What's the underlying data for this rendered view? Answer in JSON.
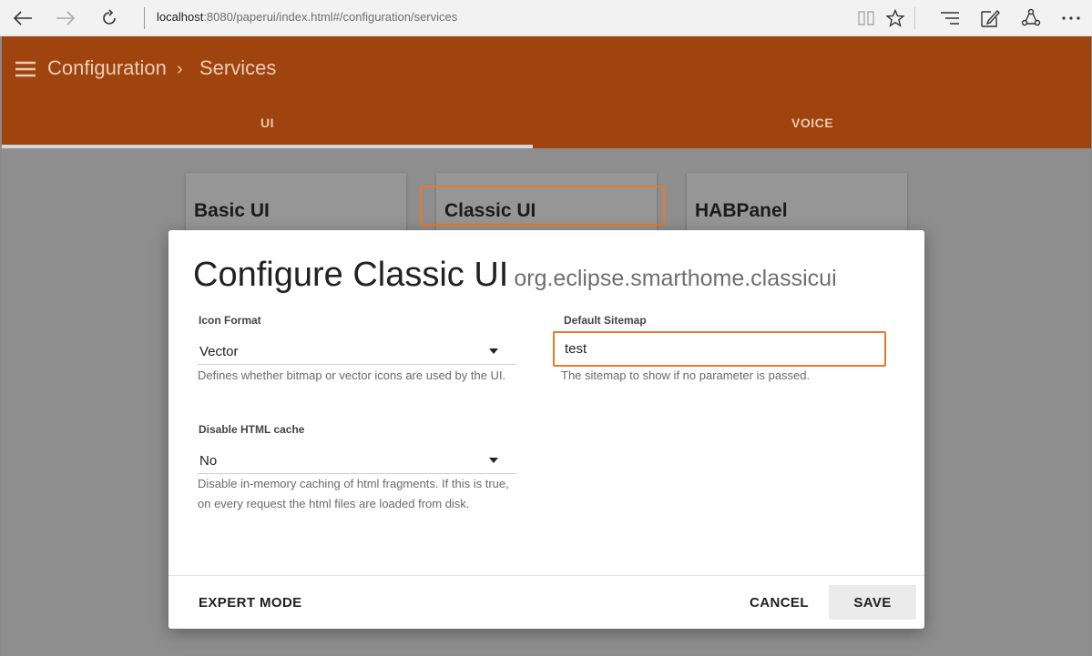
{
  "browser": {
    "url_host": "localhost",
    "url_rest": ":8080/paperui/index.html#/configuration/services",
    "icons": [
      "back-icon",
      "forward-icon",
      "refresh-icon",
      "reading-view-icon",
      "favorite-star-icon",
      "hub-icon",
      "web-note-icon",
      "share-icon",
      "more-icon"
    ]
  },
  "header": {
    "breadcrumb": [
      "Configuration",
      "Services"
    ],
    "tabs": [
      {
        "label": "UI",
        "active": true
      },
      {
        "label": "VOICE",
        "active": false
      }
    ]
  },
  "cards": [
    {
      "title": "Basic UI"
    },
    {
      "title": "Classic UI"
    },
    {
      "title": "HABPanel"
    }
  ],
  "dialog": {
    "title": "Configure Classic UI",
    "subtitle": "org.eclipse.smarthome.classicui",
    "fields": {
      "icon_format": {
        "label": "Icon Format",
        "value": "Vector",
        "help": "Defines whether bitmap or vector icons are used by the UI."
      },
      "default_sitemap": {
        "label": "Default Sitemap",
        "value": "test",
        "help": "The sitemap to show if no parameter is passed."
      },
      "disable_html_cache": {
        "label": "Disable HTML cache",
        "value": "No",
        "help_line1": "Disable in-memory caching of html fragments. If this is true,",
        "help_line2": "on every request the html files are loaded from disk."
      }
    },
    "buttons": {
      "expert_mode": "EXPERT MODE",
      "cancel": "CANCEL",
      "save": "SAVE"
    }
  },
  "colors": {
    "header_bg": "#a0440f",
    "highlight": "#e9792b"
  }
}
